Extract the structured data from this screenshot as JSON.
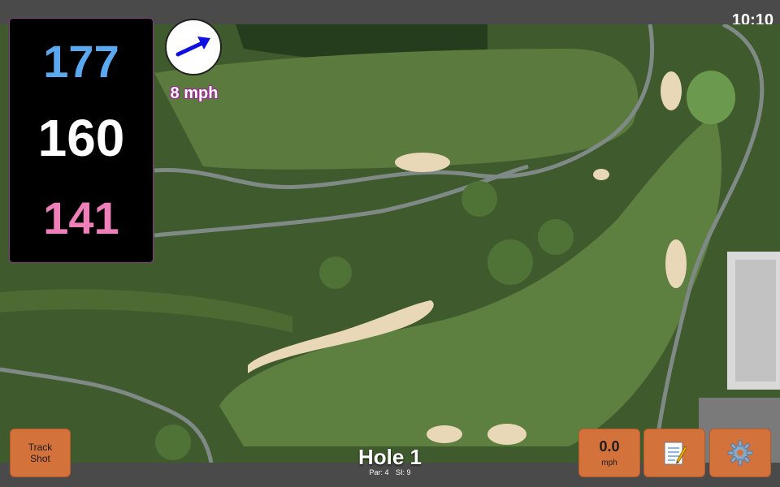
{
  "status": {
    "time": "10:10"
  },
  "yardage": {
    "back": "177",
    "middle": "160",
    "front": "141"
  },
  "wind": {
    "speed_label": "8 mph",
    "arrow_icon": "arrow-right-icon",
    "arrow_color": "#1010e0"
  },
  "buttons": {
    "track_shot": "Track\nShot",
    "speed_value": "0.0",
    "speed_unit": "mph",
    "notes_icon": "notepad-icon",
    "settings_icon": "gear-icon"
  },
  "hole": {
    "title": "Hole 1",
    "par": "Par: 4",
    "si": "SI: 9"
  },
  "colors": {
    "button": "#d4723c",
    "back_yard": "#5aa9f0",
    "front_yard": "#ef7fb9",
    "frame": "#4a4a4a"
  }
}
